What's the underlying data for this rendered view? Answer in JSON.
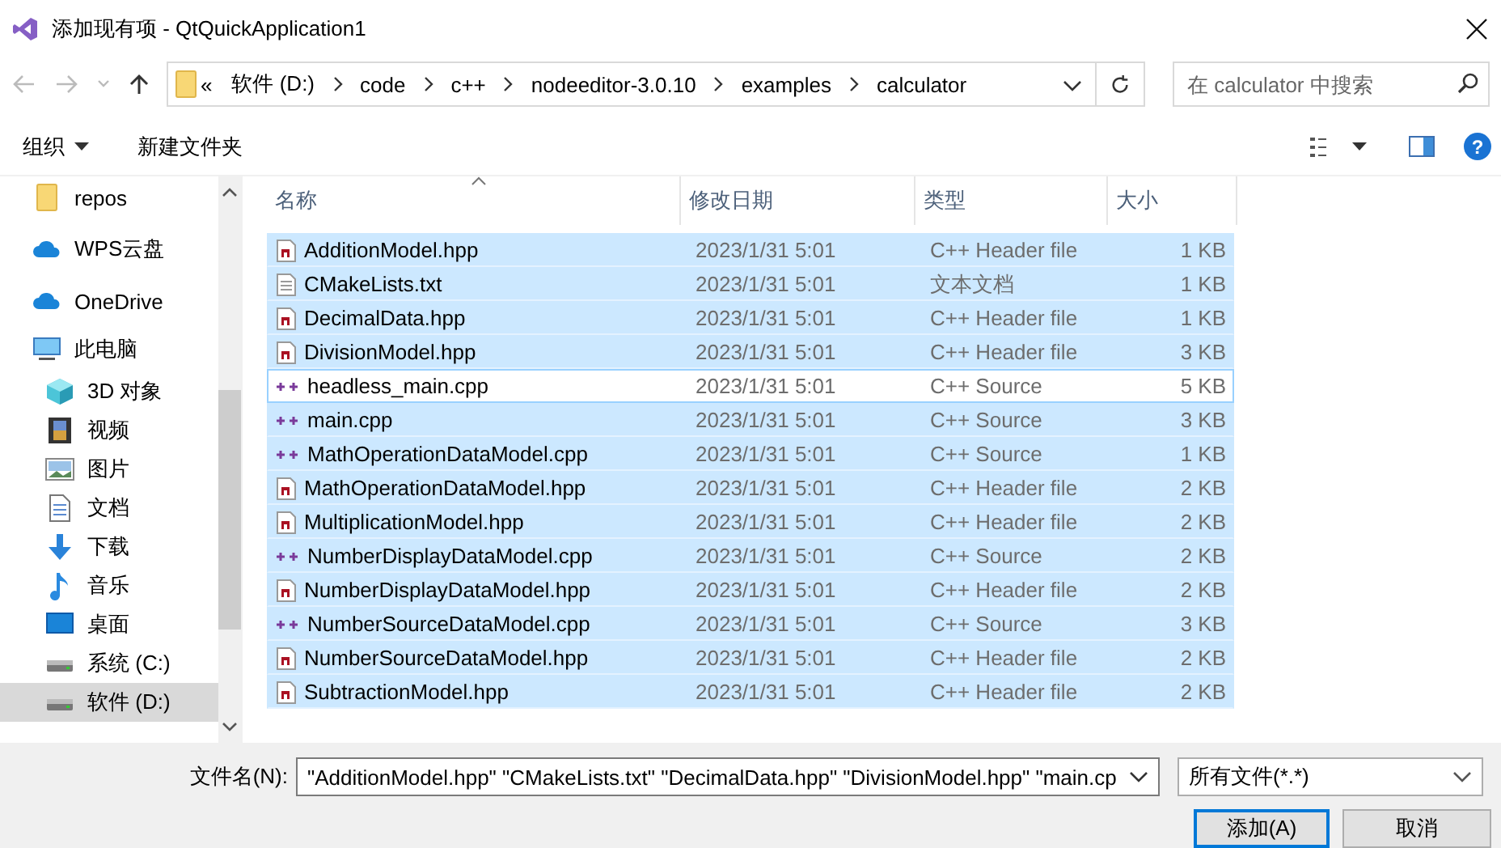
{
  "window": {
    "title": "添加现有项 - QtQuickApplication1"
  },
  "address": {
    "prefix": "«",
    "path": [
      "软件 (D:)",
      "code",
      "c++",
      "nodeeditor-3.0.10",
      "examples",
      "calculator"
    ]
  },
  "search": {
    "placeholder": "在 calculator 中搜索"
  },
  "toolbar": {
    "organize": "组织",
    "new_folder": "新建文件夹",
    "help": "?"
  },
  "sidebar": {
    "items": [
      {
        "label": "repos",
        "kind": "folder",
        "selected": false
      },
      {
        "label": "WPS云盘",
        "kind": "cloud",
        "selected": false
      },
      {
        "label": "OneDrive",
        "kind": "cloud",
        "selected": false
      },
      {
        "label": "此电脑",
        "kind": "pc",
        "selected": false,
        "children": [
          {
            "label": "3D 对象",
            "kind": "cube",
            "selected": false
          },
          {
            "label": "视频",
            "kind": "video",
            "selected": false
          },
          {
            "label": "图片",
            "kind": "image",
            "selected": false
          },
          {
            "label": "文档",
            "kind": "doc",
            "selected": false
          },
          {
            "label": "下载",
            "kind": "download",
            "selected": false
          },
          {
            "label": "音乐",
            "kind": "music",
            "selected": false
          },
          {
            "label": "桌面",
            "kind": "desktop",
            "selected": false
          },
          {
            "label": "系统 (C:)",
            "kind": "drive",
            "selected": false
          },
          {
            "label": "软件 (D:)",
            "kind": "drive",
            "selected": true
          }
        ]
      }
    ]
  },
  "table": {
    "columns": [
      "名称",
      "修改日期",
      "类型",
      "大小"
    ],
    "rows": [
      {
        "name": "AdditionModel.hpp",
        "modified": "2023/1/31 5:01",
        "type": "C++ Header file",
        "size": "1 KB",
        "kind": "header",
        "selected": true,
        "focused": false
      },
      {
        "name": "CMakeLists.txt",
        "modified": "2023/1/31 5:01",
        "type": "文本文档",
        "size": "1 KB",
        "kind": "text",
        "selected": true,
        "focused": false
      },
      {
        "name": "DecimalData.hpp",
        "modified": "2023/1/31 5:01",
        "type": "C++ Header file",
        "size": "1 KB",
        "kind": "header",
        "selected": true,
        "focused": false
      },
      {
        "name": "DivisionModel.hpp",
        "modified": "2023/1/31 5:01",
        "type": "C++ Header file",
        "size": "3 KB",
        "kind": "header",
        "selected": true,
        "focused": false
      },
      {
        "name": "headless_main.cpp",
        "modified": "2023/1/31 5:01",
        "type": "C++ Source",
        "size": "5 KB",
        "kind": "source",
        "selected": false,
        "focused": true
      },
      {
        "name": "main.cpp",
        "modified": "2023/1/31 5:01",
        "type": "C++ Source",
        "size": "3 KB",
        "kind": "source",
        "selected": true,
        "focused": false
      },
      {
        "name": "MathOperationDataModel.cpp",
        "modified": "2023/1/31 5:01",
        "type": "C++ Source",
        "size": "1 KB",
        "kind": "source",
        "selected": true,
        "focused": false
      },
      {
        "name": "MathOperationDataModel.hpp",
        "modified": "2023/1/31 5:01",
        "type": "C++ Header file",
        "size": "2 KB",
        "kind": "header",
        "selected": true,
        "focused": false
      },
      {
        "name": "MultiplicationModel.hpp",
        "modified": "2023/1/31 5:01",
        "type": "C++ Header file",
        "size": "2 KB",
        "kind": "header",
        "selected": true,
        "focused": false
      },
      {
        "name": "NumberDisplayDataModel.cpp",
        "modified": "2023/1/31 5:01",
        "type": "C++ Source",
        "size": "2 KB",
        "kind": "source",
        "selected": true,
        "focused": false
      },
      {
        "name": "NumberDisplayDataModel.hpp",
        "modified": "2023/1/31 5:01",
        "type": "C++ Header file",
        "size": "2 KB",
        "kind": "header",
        "selected": true,
        "focused": false
      },
      {
        "name": "NumberSourceDataModel.cpp",
        "modified": "2023/1/31 5:01",
        "type": "C++ Source",
        "size": "3 KB",
        "kind": "source",
        "selected": true,
        "focused": false
      },
      {
        "name": "NumberSourceDataModel.hpp",
        "modified": "2023/1/31 5:01",
        "type": "C++ Header file",
        "size": "2 KB",
        "kind": "header",
        "selected": true,
        "focused": false
      },
      {
        "name": "SubtractionModel.hpp",
        "modified": "2023/1/31 5:01",
        "type": "C++ Header file",
        "size": "2 KB",
        "kind": "header",
        "selected": true,
        "focused": false
      }
    ]
  },
  "footer": {
    "filename_label": "文件名(N):",
    "filename": "\"AdditionModel.hpp\" \"CMakeLists.txt\" \"DecimalData.hpp\" \"DivisionModel.hpp\" \"main.cp",
    "filter": "所有文件(*.*)",
    "buttons": [
      {
        "label": "添加(A)",
        "kind": "primary"
      },
      {
        "label": "取消",
        "kind": "normal"
      }
    ]
  }
}
